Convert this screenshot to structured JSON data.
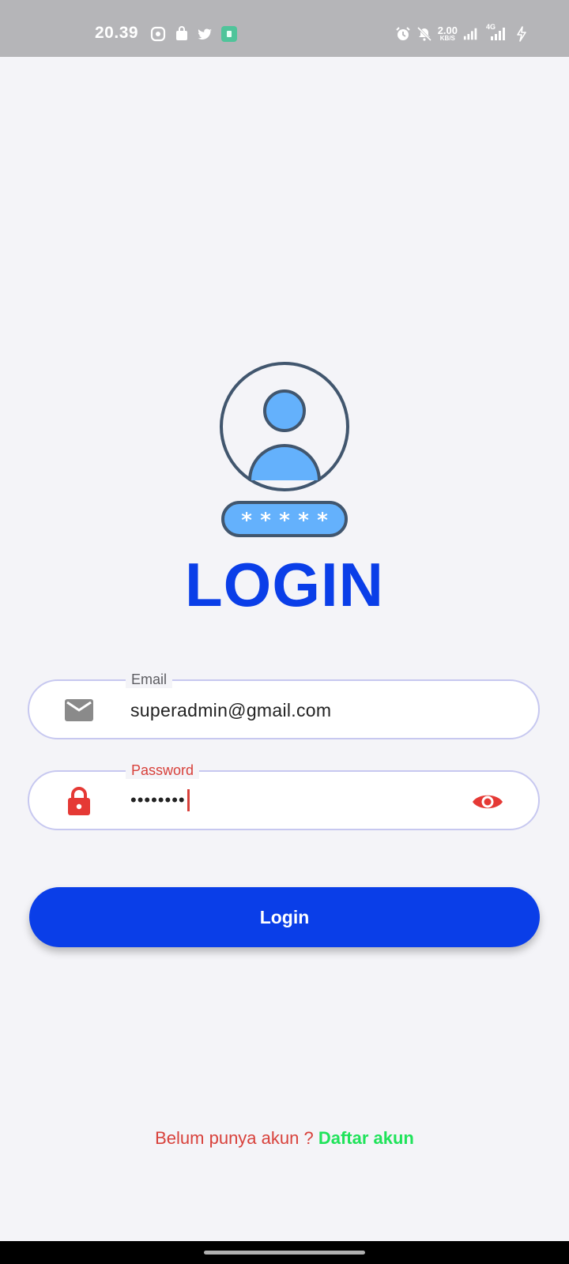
{
  "status_bar": {
    "time": "20.39",
    "net_speed_value": "2.00",
    "net_speed_unit": "KB/S",
    "network_type": "4G"
  },
  "login": {
    "title": "LOGIN",
    "email_label": "Email",
    "email_value": "superadmin@gmail.com",
    "password_label": "Password",
    "password_masked": "••••••••",
    "button_label": "Login",
    "register_prompt": "Belum punya akun ? ",
    "register_link": "Daftar akun"
  },
  "colors": {
    "primary": "#0a3ee8",
    "error_red": "#d8413b",
    "link_green": "#1fe35a",
    "field_border": "#c7c8f0",
    "logo_blue": "#64b1fc",
    "logo_outline": "#41566e"
  },
  "icons": {
    "email": "mail-icon",
    "password": "lock-icon",
    "toggle_visibility": "eye-icon"
  }
}
